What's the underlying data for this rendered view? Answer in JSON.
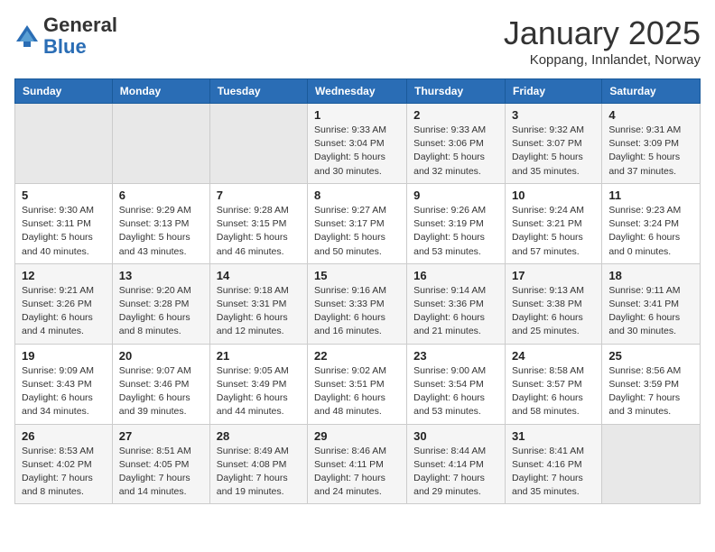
{
  "app": {
    "logo_general": "General",
    "logo_blue": "Blue",
    "month": "January 2025",
    "location": "Koppang, Innlandet, Norway"
  },
  "headers": [
    "Sunday",
    "Monday",
    "Tuesday",
    "Wednesday",
    "Thursday",
    "Friday",
    "Saturday"
  ],
  "weeks": [
    [
      {
        "day": "",
        "info": ""
      },
      {
        "day": "",
        "info": ""
      },
      {
        "day": "",
        "info": ""
      },
      {
        "day": "1",
        "info": "Sunrise: 9:33 AM\nSunset: 3:04 PM\nDaylight: 5 hours\nand 30 minutes."
      },
      {
        "day": "2",
        "info": "Sunrise: 9:33 AM\nSunset: 3:06 PM\nDaylight: 5 hours\nand 32 minutes."
      },
      {
        "day": "3",
        "info": "Sunrise: 9:32 AM\nSunset: 3:07 PM\nDaylight: 5 hours\nand 35 minutes."
      },
      {
        "day": "4",
        "info": "Sunrise: 9:31 AM\nSunset: 3:09 PM\nDaylight: 5 hours\nand 37 minutes."
      }
    ],
    [
      {
        "day": "5",
        "info": "Sunrise: 9:30 AM\nSunset: 3:11 PM\nDaylight: 5 hours\nand 40 minutes."
      },
      {
        "day": "6",
        "info": "Sunrise: 9:29 AM\nSunset: 3:13 PM\nDaylight: 5 hours\nand 43 minutes."
      },
      {
        "day": "7",
        "info": "Sunrise: 9:28 AM\nSunset: 3:15 PM\nDaylight: 5 hours\nand 46 minutes."
      },
      {
        "day": "8",
        "info": "Sunrise: 9:27 AM\nSunset: 3:17 PM\nDaylight: 5 hours\nand 50 minutes."
      },
      {
        "day": "9",
        "info": "Sunrise: 9:26 AM\nSunset: 3:19 PM\nDaylight: 5 hours\nand 53 minutes."
      },
      {
        "day": "10",
        "info": "Sunrise: 9:24 AM\nSunset: 3:21 PM\nDaylight: 5 hours\nand 57 minutes."
      },
      {
        "day": "11",
        "info": "Sunrise: 9:23 AM\nSunset: 3:24 PM\nDaylight: 6 hours\nand 0 minutes."
      }
    ],
    [
      {
        "day": "12",
        "info": "Sunrise: 9:21 AM\nSunset: 3:26 PM\nDaylight: 6 hours\nand 4 minutes."
      },
      {
        "day": "13",
        "info": "Sunrise: 9:20 AM\nSunset: 3:28 PM\nDaylight: 6 hours\nand 8 minutes."
      },
      {
        "day": "14",
        "info": "Sunrise: 9:18 AM\nSunset: 3:31 PM\nDaylight: 6 hours\nand 12 minutes."
      },
      {
        "day": "15",
        "info": "Sunrise: 9:16 AM\nSunset: 3:33 PM\nDaylight: 6 hours\nand 16 minutes."
      },
      {
        "day": "16",
        "info": "Sunrise: 9:14 AM\nSunset: 3:36 PM\nDaylight: 6 hours\nand 21 minutes."
      },
      {
        "day": "17",
        "info": "Sunrise: 9:13 AM\nSunset: 3:38 PM\nDaylight: 6 hours\nand 25 minutes."
      },
      {
        "day": "18",
        "info": "Sunrise: 9:11 AM\nSunset: 3:41 PM\nDaylight: 6 hours\nand 30 minutes."
      }
    ],
    [
      {
        "day": "19",
        "info": "Sunrise: 9:09 AM\nSunset: 3:43 PM\nDaylight: 6 hours\nand 34 minutes."
      },
      {
        "day": "20",
        "info": "Sunrise: 9:07 AM\nSunset: 3:46 PM\nDaylight: 6 hours\nand 39 minutes."
      },
      {
        "day": "21",
        "info": "Sunrise: 9:05 AM\nSunset: 3:49 PM\nDaylight: 6 hours\nand 44 minutes."
      },
      {
        "day": "22",
        "info": "Sunrise: 9:02 AM\nSunset: 3:51 PM\nDaylight: 6 hours\nand 48 minutes."
      },
      {
        "day": "23",
        "info": "Sunrise: 9:00 AM\nSunset: 3:54 PM\nDaylight: 6 hours\nand 53 minutes."
      },
      {
        "day": "24",
        "info": "Sunrise: 8:58 AM\nSunset: 3:57 PM\nDaylight: 6 hours\nand 58 minutes."
      },
      {
        "day": "25",
        "info": "Sunrise: 8:56 AM\nSunset: 3:59 PM\nDaylight: 7 hours\nand 3 minutes."
      }
    ],
    [
      {
        "day": "26",
        "info": "Sunrise: 8:53 AM\nSunset: 4:02 PM\nDaylight: 7 hours\nand 8 minutes."
      },
      {
        "day": "27",
        "info": "Sunrise: 8:51 AM\nSunset: 4:05 PM\nDaylight: 7 hours\nand 14 minutes."
      },
      {
        "day": "28",
        "info": "Sunrise: 8:49 AM\nSunset: 4:08 PM\nDaylight: 7 hours\nand 19 minutes."
      },
      {
        "day": "29",
        "info": "Sunrise: 8:46 AM\nSunset: 4:11 PM\nDaylight: 7 hours\nand 24 minutes."
      },
      {
        "day": "30",
        "info": "Sunrise: 8:44 AM\nSunset: 4:14 PM\nDaylight: 7 hours\nand 29 minutes."
      },
      {
        "day": "31",
        "info": "Sunrise: 8:41 AM\nSunset: 4:16 PM\nDaylight: 7 hours\nand 35 minutes."
      },
      {
        "day": "",
        "info": ""
      }
    ]
  ]
}
